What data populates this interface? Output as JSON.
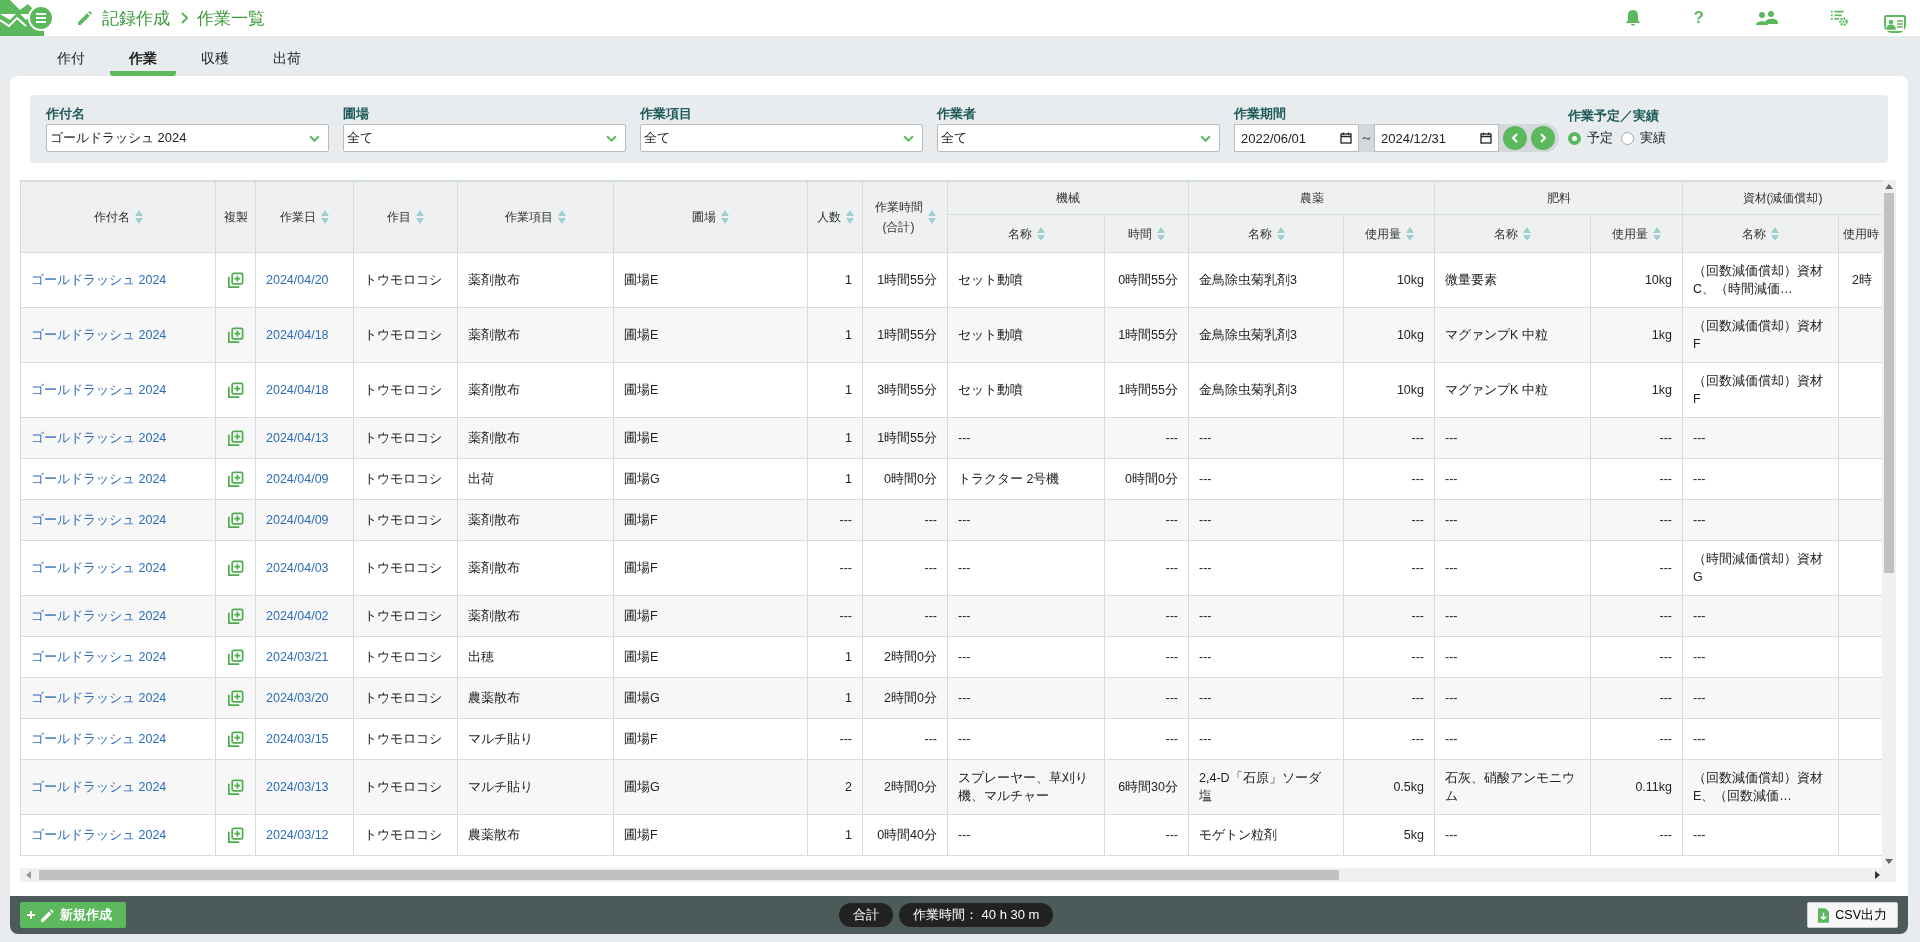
{
  "header": {
    "breadcrumb": [
      "記録作成",
      "作業一覧"
    ],
    "help": "?"
  },
  "tabs": [
    {
      "label": "作付",
      "selected": false
    },
    {
      "label": "作業",
      "selected": true
    },
    {
      "label": "収穫",
      "selected": false
    },
    {
      "label": "出荷",
      "selected": false
    }
  ],
  "filters": {
    "selects": [
      {
        "label": "作付名",
        "value": "ゴールドラッシュ 2024"
      },
      {
        "label": "圃場",
        "value": "全て"
      },
      {
        "label": "作業項目",
        "value": "全て"
      },
      {
        "label": "作業者",
        "value": "全て"
      }
    ],
    "period": {
      "label": "作業期間",
      "from": "2022/06/01",
      "separator": "～",
      "to": "2024/12/31"
    },
    "status": {
      "label": "作業予定／実績",
      "options": [
        {
          "label": "予定",
          "selected": true
        },
        {
          "label": "実績",
          "selected": false
        }
      ]
    }
  },
  "table": {
    "columns": [
      {
        "label": "作付名",
        "sortable": true
      },
      {
        "label": "複製",
        "sortable": false
      },
      {
        "label": "作業日",
        "sortable": true
      },
      {
        "label": "作目",
        "sortable": true
      },
      {
        "label": "作業項目",
        "sortable": true
      },
      {
        "label": "圃場",
        "sortable": true
      },
      {
        "label": "人数",
        "sortable": true
      },
      {
        "label": "作業時間",
        "note": "(合計)",
        "sortable": true
      }
    ],
    "groups": [
      {
        "label": "機械",
        "columns": [
          {
            "label": "名称",
            "sortable": true
          },
          {
            "label": "時間",
            "sortable": true
          }
        ]
      },
      {
        "label": "農薬",
        "columns": [
          {
            "label": "名称",
            "sortable": true
          },
          {
            "label": "使用量",
            "sortable": true
          }
        ]
      },
      {
        "label": "肥料",
        "columns": [
          {
            "label": "名称",
            "sortable": true
          },
          {
            "label": "使用量",
            "sortable": true
          }
        ]
      },
      {
        "label": "資材(減価償却)",
        "columns": [
          {
            "label": "名称",
            "sortable": true
          },
          {
            "label": "使用時",
            "sortable": false
          }
        ]
      }
    ],
    "rows": [
      {
        "crop_name": "ゴールドラッシュ 2024",
        "date": "2024/04/20",
        "crop": "トウモロコシ",
        "task": "薬剤散布",
        "field": "圃場E",
        "workers": "1",
        "hours": "1時間55分",
        "machine": "セット動噴",
        "machine_time": "0時間55分",
        "pesticide": "金鳥除虫菊乳剤3",
        "pesticide_amount": "10kg",
        "fertilizer": "微量要素",
        "fertilizer_amount": "10kg",
        "material": "（回数減価償却）資材C、（時間減価…",
        "material_time": "2時"
      },
      {
        "crop_name": "ゴールドラッシュ 2024",
        "date": "2024/04/18",
        "crop": "トウモロコシ",
        "task": "薬剤散布",
        "field": "圃場E",
        "workers": "1",
        "hours": "1時間55分",
        "machine": "セット動噴",
        "machine_time": "1時間55分",
        "pesticide": "金鳥除虫菊乳剤3",
        "pesticide_amount": "10kg",
        "fertilizer": "マグァンプK 中粒",
        "fertilizer_amount": "1kg",
        "material": "（回数減価償却）資材F"
      },
      {
        "crop_name": "ゴールドラッシュ 2024",
        "date": "2024/04/18",
        "crop": "トウモロコシ",
        "task": "薬剤散布",
        "field": "圃場E",
        "workers": "1",
        "hours": "3時間55分",
        "machine": "セット動噴",
        "machine_time": "1時間55分",
        "pesticide": "金鳥除虫菊乳剤3",
        "pesticide_amount": "10kg",
        "fertilizer": "マグァンプK 中粒",
        "fertilizer_amount": "1kg",
        "material": "（回数減価償却）資材F"
      },
      {
        "crop_name": "ゴールドラッシュ 2024",
        "date": "2024/04/13",
        "crop": "トウモロコシ",
        "task": "薬剤散布",
        "field": "圃場E",
        "workers": "1",
        "hours": "1時間55分",
        "machine": "---",
        "machine_time": "---",
        "pesticide": "---",
        "pesticide_amount": "---",
        "fertilizer": "---",
        "fertilizer_amount": "---",
        "material": "---"
      },
      {
        "crop_name": "ゴールドラッシュ 2024",
        "date": "2024/04/09",
        "crop": "トウモロコシ",
        "task": "出荷",
        "field": "圃場G",
        "workers": "1",
        "hours": "0時間0分",
        "machine": "トラクター 2号機",
        "machine_time": "0時間0分",
        "pesticide": "---",
        "pesticide_amount": "---",
        "fertilizer": "---",
        "fertilizer_amount": "---",
        "material": "---"
      },
      {
        "crop_name": "ゴールドラッシュ 2024",
        "date": "2024/04/09",
        "crop": "トウモロコシ",
        "task": "薬剤散布",
        "field": "圃場F",
        "workers": "---",
        "hours": "---",
        "machine": "---",
        "machine_time": "---",
        "pesticide": "---",
        "pesticide_amount": "---",
        "fertilizer": "---",
        "fertilizer_amount": "---",
        "material": "---"
      },
      {
        "crop_name": "ゴールドラッシュ 2024",
        "date": "2024/04/03",
        "crop": "トウモロコシ",
        "task": "薬剤散布",
        "field": "圃場F",
        "workers": "---",
        "hours": "---",
        "machine": "---",
        "machine_time": "---",
        "pesticide": "---",
        "pesticide_amount": "---",
        "fertilizer": "---",
        "fertilizer_amount": "---",
        "material": "（時間減価償却）資材G"
      },
      {
        "crop_name": "ゴールドラッシュ 2024",
        "date": "2024/04/02",
        "crop": "トウモロコシ",
        "task": "薬剤散布",
        "field": "圃場F",
        "workers": "---",
        "hours": "---",
        "machine": "---",
        "machine_time": "---",
        "pesticide": "---",
        "pesticide_amount": "---",
        "fertilizer": "---",
        "fertilizer_amount": "---",
        "material": "---"
      },
      {
        "crop_name": "ゴールドラッシュ 2024",
        "date": "2024/03/21",
        "crop": "トウモロコシ",
        "task": "出穂",
        "field": "圃場E",
        "workers": "1",
        "hours": "2時間0分",
        "machine": "---",
        "machine_time": "---",
        "pesticide": "---",
        "pesticide_amount": "---",
        "fertilizer": "---",
        "fertilizer_amount": "---",
        "material": "---"
      },
      {
        "crop_name": "ゴールドラッシュ 2024",
        "date": "2024/03/20",
        "crop": "トウモロコシ",
        "task": "農薬散布",
        "field": "圃場G",
        "workers": "1",
        "hours": "2時間0分",
        "machine": "---",
        "machine_time": "---",
        "pesticide": "---",
        "pesticide_amount": "---",
        "fertilizer": "---",
        "fertilizer_amount": "---",
        "material": "---"
      },
      {
        "crop_name": "ゴールドラッシュ 2024",
        "date": "2024/03/15",
        "crop": "トウモロコシ",
        "task": "マルチ貼り",
        "field": "圃場F",
        "workers": "---",
        "hours": "---",
        "machine": "---",
        "machine_time": "---",
        "pesticide": "---",
        "pesticide_amount": "---",
        "fertilizer": "---",
        "fertilizer_amount": "---",
        "material": "---"
      },
      {
        "crop_name": "ゴールドラッシュ 2024",
        "date": "2024/03/13",
        "crop": "トウモロコシ",
        "task": "マルチ貼り",
        "field": "圃場G",
        "workers": "2",
        "hours": "2時間0分",
        "machine": "スプレーヤー、草刈り機、マルチャー",
        "machine_time": "6時間30分",
        "pesticide": "2,4-D「石原」ソーダ塩",
        "pesticide_amount": "0.5kg",
        "fertilizer": "石灰、硝酸アンモニウム",
        "fertilizer_amount": "0.11kg",
        "material": "（回数減価償却）資材E、（回数減価…"
      },
      {
        "crop_name": "ゴールドラッシュ 2024",
        "date": "2024/03/12",
        "crop": "トウモロコシ",
        "task": "農薬散布",
        "field": "圃場F",
        "workers": "1",
        "hours": "0時間40分",
        "machine": "---",
        "machine_time": "---",
        "pesticide": "モゲトン粒剤",
        "pesticide_amount": "5kg",
        "fertilizer": "---",
        "fertilizer_amount": "---",
        "material": "---"
      }
    ]
  },
  "footer": {
    "new_button": "新規作成",
    "total_label": "合計",
    "work_time": "作業時間： 40 h 30 m",
    "csv_button": "CSV出力"
  }
}
